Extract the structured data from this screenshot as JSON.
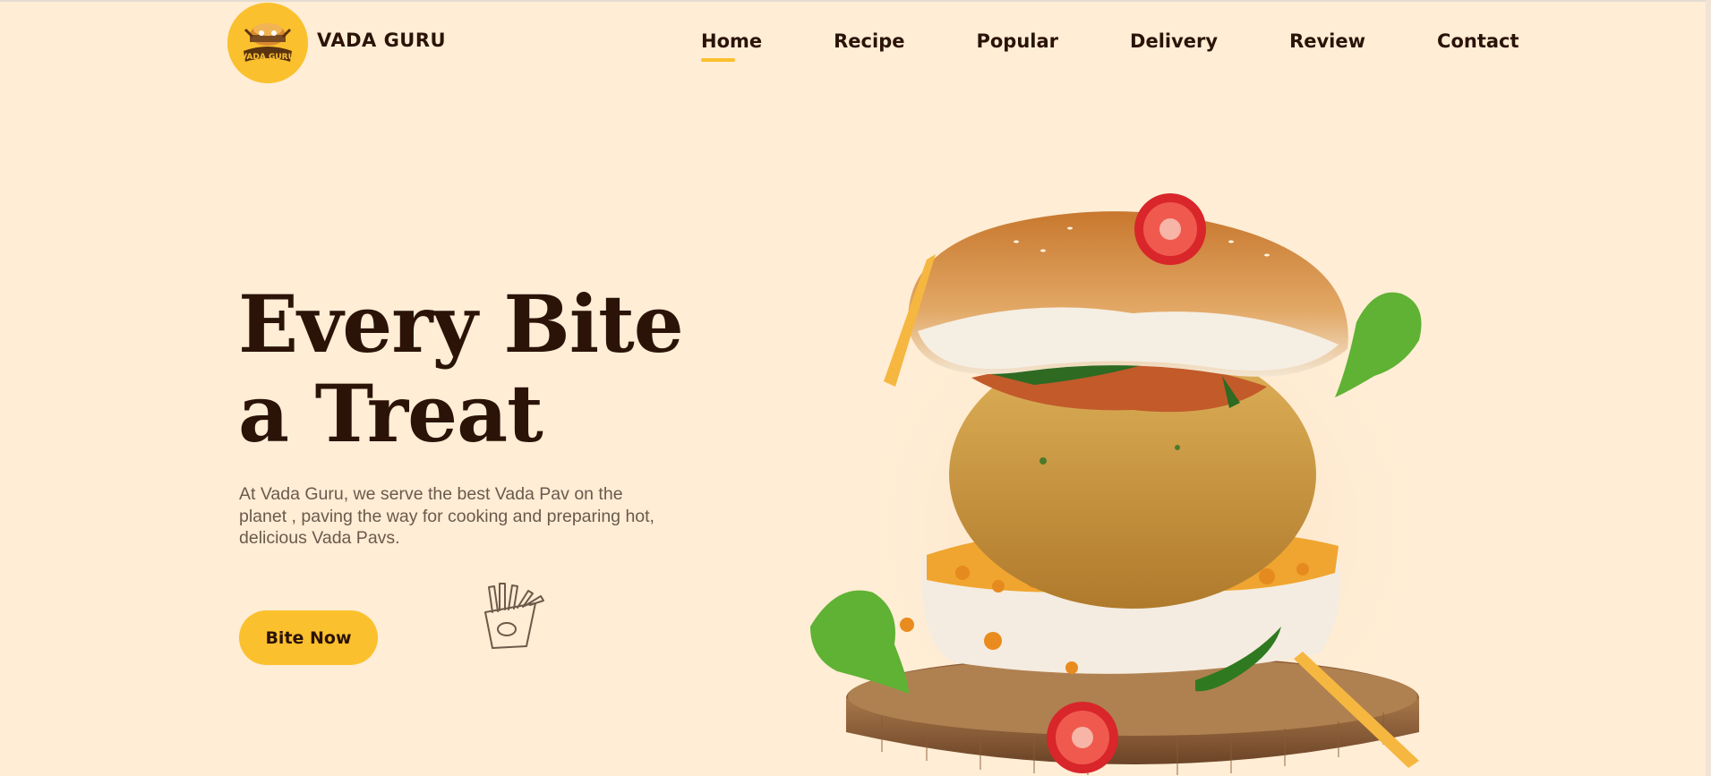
{
  "header": {
    "logo_text": "VADA GURU",
    "brand_name": "VADA GURU",
    "nav": [
      {
        "label": "Home",
        "active": true
      },
      {
        "label": "Recipe",
        "active": false
      },
      {
        "label": "Popular",
        "active": false
      },
      {
        "label": "Delivery",
        "active": false
      },
      {
        "label": "Review",
        "active": false
      },
      {
        "label": "Contact",
        "active": false
      }
    ]
  },
  "hero": {
    "title_line1": "Every Bite",
    "title_line2": "a Treat",
    "description": "At Vada Guru, we serve the best Vada Pav on the planet , paving the way for cooking and preparing hot, delicious Vada Pavs.",
    "cta_label": "Bite Now",
    "doodle_icon": "fries-doodle-icon",
    "image": "vada-pav-burger-on-wooden-board"
  },
  "colors": {
    "background": "#FFEDD5",
    "accent": "#FBC02D",
    "text": "#2B1308",
    "muted_text": "#6A5A4C"
  }
}
